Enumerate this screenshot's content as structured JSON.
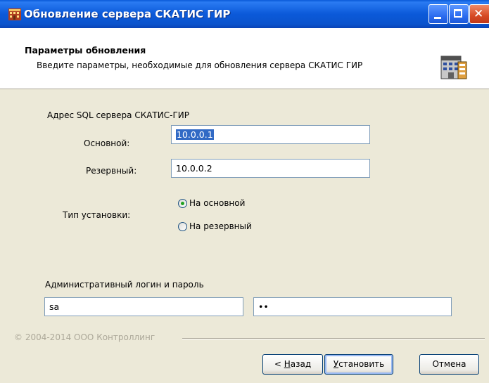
{
  "window": {
    "title": "Обновление сервера СКАТИС ГИР"
  },
  "header": {
    "title": "Параметры обновления",
    "subtitle": "Введите параметры, необходимые для обновления сервера СКАТИС ГИР"
  },
  "sql": {
    "section_label": "Адрес SQL сервера СКАТИС-ГИР",
    "primary_label": "Основной:",
    "primary_value": "10.0.0.1",
    "backup_label": "Резервный:",
    "backup_value": "10.0.0.2"
  },
  "install": {
    "type_label": "Тип установки:",
    "options": [
      {
        "label": "На основной",
        "checked": true
      },
      {
        "label": "На резервный",
        "checked": false
      }
    ]
  },
  "admin": {
    "label": "Административный логин и пароль",
    "login_value": "sa",
    "password_value": "••"
  },
  "footer": {
    "copyright": "© 2004-2014 ООО Контроллинг",
    "back_label_hotkey": "Н",
    "back_label_rest": "азад",
    "back_prefix": "< ",
    "install_hotkey": "У",
    "install_rest": "становить",
    "cancel_label": "Отмена"
  }
}
